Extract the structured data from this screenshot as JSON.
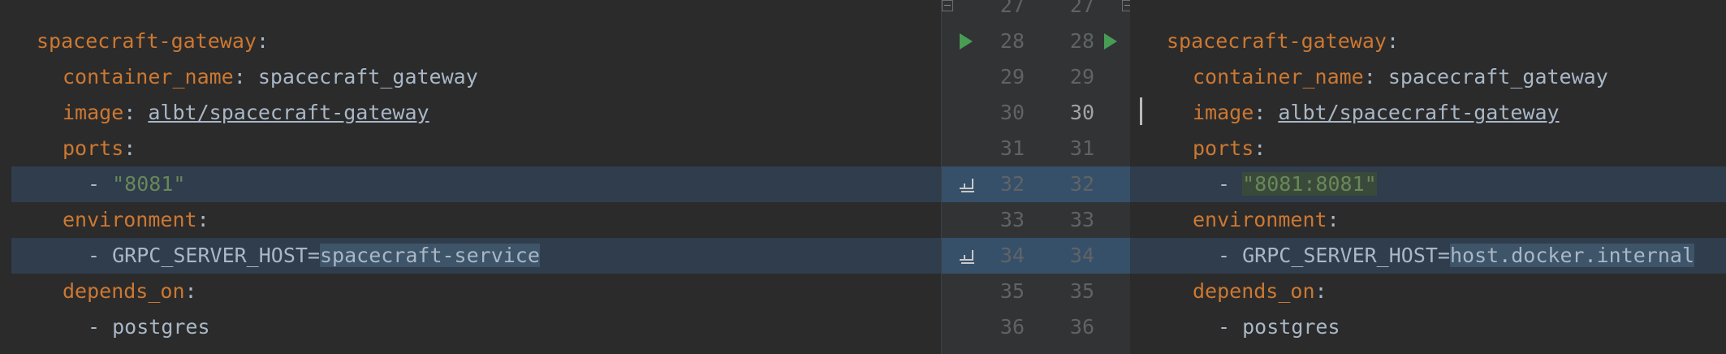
{
  "left_pane": {
    "lines": [
      {
        "indent": "",
        "key": "spacecraft-gateway",
        "colon": ":",
        "value": ""
      },
      {
        "indent": "  ",
        "key": "container_name",
        "colon": ":",
        "value": " spacecraft_gateway"
      },
      {
        "indent": "  ",
        "key": "image",
        "colon": ":",
        "value": " ",
        "link": "albt/spacecraft-gateway"
      },
      {
        "indent": "  ",
        "key": "ports",
        "colon": ":",
        "value": ""
      },
      {
        "indent": "    ",
        "dash": "- ",
        "string": "\"8081\""
      },
      {
        "indent": "  ",
        "key": "environment",
        "colon": ":",
        "value": ""
      },
      {
        "indent": "    ",
        "dash": "- ",
        "plain": "GRPC_SERVER_HOST=",
        "highlight": "spacecraft-service"
      },
      {
        "indent": "  ",
        "key": "depends_on",
        "colon": ":",
        "value": ""
      },
      {
        "indent": "    ",
        "dash": "- ",
        "plain": "postgres"
      }
    ]
  },
  "right_pane": {
    "lines": [
      {
        "indent": "",
        "key": "spacecraft-gateway",
        "colon": ":",
        "value": ""
      },
      {
        "indent": "  ",
        "key": "container_name",
        "colon": ":",
        "value": " spacecraft_gateway"
      },
      {
        "indent": "  ",
        "key": "image",
        "colon": ":",
        "value": " ",
        "link": "albt/spacecraft-gateway"
      },
      {
        "indent": "  ",
        "key": "ports",
        "colon": ":",
        "value": ""
      },
      {
        "indent": "    ",
        "dash": "- ",
        "string": "\"8081:8081\""
      },
      {
        "indent": "  ",
        "key": "environment",
        "colon": ":",
        "value": ""
      },
      {
        "indent": "    ",
        "dash": "- ",
        "plain": "GRPC_SERVER_HOST=",
        "highlight": "host.docker.internal"
      },
      {
        "indent": "  ",
        "key": "depends_on",
        "colon": ":",
        "value": ""
      },
      {
        "indent": "    ",
        "dash": "- ",
        "plain": "postgres"
      }
    ]
  },
  "gutter": {
    "left_numbers": [
      "27",
      "28",
      "29",
      "30",
      "31",
      "32",
      "33",
      "34",
      "35",
      "36"
    ],
    "right_numbers": [
      "27",
      "28",
      "29",
      "30",
      "31",
      "32",
      "33",
      "34",
      "35",
      "36"
    ]
  },
  "colors": {
    "background": "#2b2b2b",
    "key": "#cc7832",
    "string": "#6a8759",
    "changed_line": "#2f3d4d",
    "run_icon": "#499c54"
  }
}
